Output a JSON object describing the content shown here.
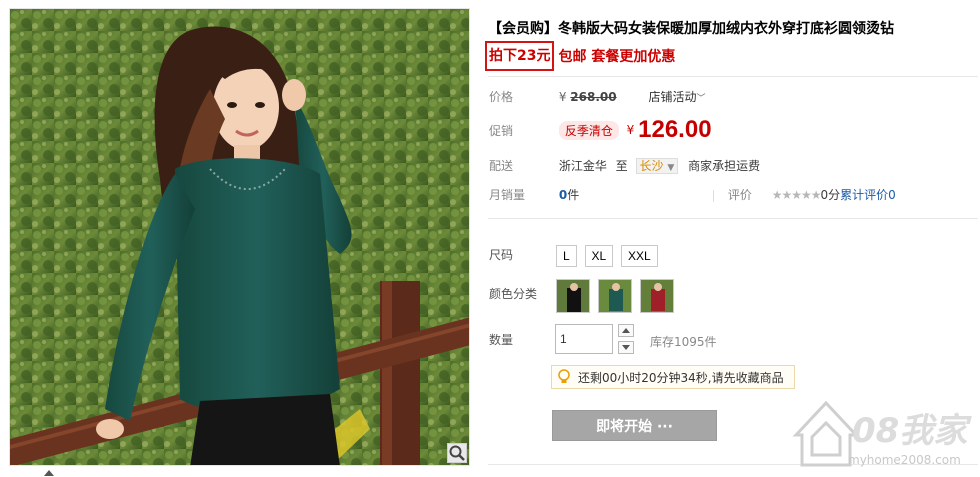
{
  "product": {
    "title": "【会员购】冬韩版大码女装保暖加厚加绒内衣外穿打底衫圆领烫钻",
    "promo_box": "拍下23元",
    "promo_rest": "包邮 套餐更加优惠"
  },
  "price": {
    "label": "价格",
    "currency": "¥",
    "original": "268.00",
    "shop_activity": "店铺活动",
    "promo_label": "促销",
    "promo_tag": "反季清仓",
    "promo_price": "126.00"
  },
  "shipping": {
    "label": "配送",
    "from": "浙江金华",
    "to_word": "至",
    "to_city": "长沙",
    "fee_note": "商家承担运费"
  },
  "stats": {
    "monthly_label": "月销量",
    "monthly_count": "0",
    "monthly_unit": "件",
    "rating_label": "评价",
    "stars": "★★★★★",
    "score": "0分",
    "review_link": "累计评价",
    "review_count": "0"
  },
  "options": {
    "size_label": "尺码",
    "sizes": [
      "L",
      "XL",
      "XXL"
    ],
    "color_label": "颜色分类",
    "colors": [
      "black-coat",
      "green-top",
      "red-top"
    ]
  },
  "quantity": {
    "label": "数量",
    "value": "1",
    "stock": "库存1095件"
  },
  "tip": {
    "text": "还剩00小时20分钟34秒,请先收藏商品"
  },
  "cta": {
    "label": "即将开始 ···"
  },
  "watermark": {
    "big": "08我家",
    "url": "myhome2008.com"
  },
  "icons": [
    "zoom-icon",
    "dropdown-arrow-icon",
    "lightbulb-icon",
    "spin-up-icon",
    "spin-down-icon"
  ],
  "colors": {
    "accent_red": "#c40000",
    "link_blue": "#1a5ba6",
    "cta_gray": "#a6a6a6"
  }
}
